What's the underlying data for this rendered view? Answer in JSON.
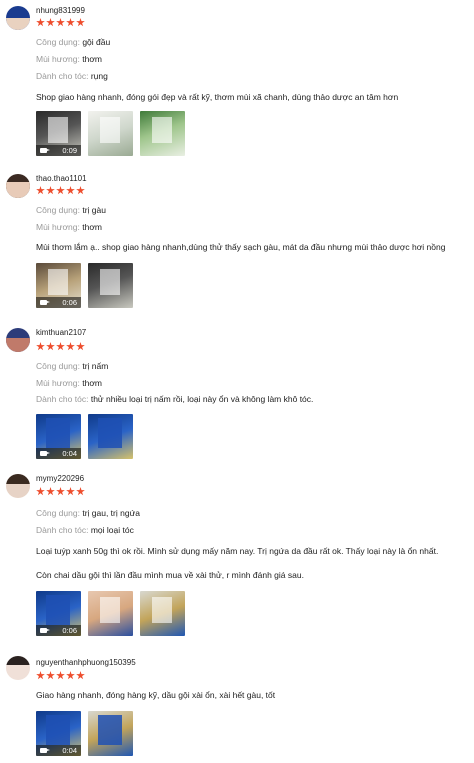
{
  "reviews": [
    {
      "username": "nhung831999",
      "rating": 5,
      "attributes": [
        {
          "key": "Công dụng:",
          "value": "gội đầu"
        },
        {
          "key": "Mùi hương:",
          "value": "thơm"
        },
        {
          "key": "Dành cho tóc:",
          "value": "rụng"
        }
      ],
      "text_lines": [
        "Shop giao hàng nhanh, đóng gói đẹp và rất kỹ, thơm mùi xã chanh, dùng thảo dược an tâm hơn"
      ],
      "media": [
        {
          "kind": "video",
          "duration": "0:09"
        },
        {
          "kind": "image"
        },
        {
          "kind": "image"
        }
      ]
    },
    {
      "username": "thao.thao1101",
      "rating": 5,
      "attributes": [
        {
          "key": "Công dụng:",
          "value": "trị gàu"
        },
        {
          "key": "Mùi hương:",
          "value": "thơm"
        }
      ],
      "text_lines": [
        "Mùi thơm lắm ạ.. shop giao hàng nhanh,dùng thử thấy sạch gàu, mát da đầu nhưng mùi thảo dược hơi nồng"
      ],
      "media": [
        {
          "kind": "video",
          "duration": "0:06"
        },
        {
          "kind": "image"
        }
      ]
    },
    {
      "username": "kimthuan2107",
      "rating": 5,
      "attributes": [
        {
          "key": "Công dụng:",
          "value": "trị nấm"
        },
        {
          "key": "Mùi hương:",
          "value": "thơm"
        },
        {
          "key": "Dành cho tóc:",
          "value": "thử nhiều loại trị nấm rồi, loại này ổn và không làm khô tóc."
        }
      ],
      "text_lines": [],
      "media": [
        {
          "kind": "video",
          "duration": "0:04"
        },
        {
          "kind": "image"
        }
      ]
    },
    {
      "username": "mymy220296",
      "rating": 5,
      "attributes": [
        {
          "key": "Công dụng:",
          "value": "trị gau, trị ngứa"
        },
        {
          "key": "Dành cho tóc:",
          "value": "mọi loại tóc"
        }
      ],
      "text_lines": [
        "Loại tuýp xanh 50g thì ok rồi. Mình sử dụng mấy năm nay. Trị ngứa da đầu rất ok. Thấy loại này là ổn nhất.",
        "Còn chai dầu gội thì lần đầu mình mua về xài thử, r mình đánh giá sau."
      ],
      "media": [
        {
          "kind": "video",
          "duration": "0:06"
        },
        {
          "kind": "image"
        },
        {
          "kind": "image"
        }
      ]
    },
    {
      "username": "nguyenthanhphuong150395",
      "rating": 5,
      "attributes": [],
      "text_lines": [
        "Giao hàng nhanh, đóng hàng kỹ, dầu gội xài ổn, xài hết gàu, tốt"
      ],
      "media": [
        {
          "kind": "video",
          "duration": "0:04"
        },
        {
          "kind": "image"
        }
      ]
    }
  ]
}
